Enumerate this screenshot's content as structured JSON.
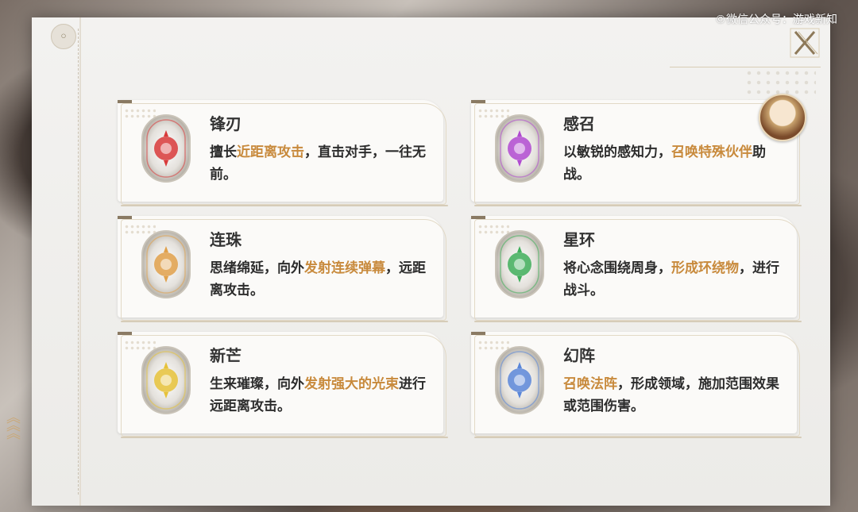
{
  "watermark": "©微信公众号：游戏新知",
  "colors": {
    "highlight": "#c88a3c",
    "panel": "#f3f2f0",
    "gold": "#c9a877"
  },
  "icons": {
    "close": "close-x-icon",
    "back": "back-circle-icon"
  },
  "cards": [
    {
      "title": "锋刃",
      "desc_parts": [
        "擅长",
        "近距离攻击",
        "，直击对手，一往无前。"
      ],
      "emblem_color": "#d83a3a",
      "emblem": "blade-emblem-icon"
    },
    {
      "title": "感召",
      "desc_parts": [
        "以敏锐的感知力，",
        "召唤特殊伙伴",
        "助战。"
      ],
      "emblem_color": "#b04ad0",
      "emblem": "summon-emblem-icon"
    },
    {
      "title": "连珠",
      "desc_parts": [
        "思绪绵延，向外",
        "发射连续弹幕",
        "，远距离攻击。"
      ],
      "emblem_color": "#e0a04a",
      "emblem": "barrage-emblem-icon"
    },
    {
      "title": "星环",
      "desc_parts": [
        "将心念围绕周身，",
        "形成环绕物",
        "，进行战斗。"
      ],
      "emblem_color": "#3fae5a",
      "emblem": "ring-emblem-icon"
    },
    {
      "title": "新芒",
      "desc_parts": [
        "生来璀璨，向外",
        "发射强大的光束",
        "进行远距离攻击。"
      ],
      "emblem_color": "#e6c23a",
      "emblem": "beam-emblem-icon"
    },
    {
      "title": "幻阵",
      "desc_parts": [
        "",
        "召唤法阵",
        "，形成领域，施加范围效果或范围伤害。"
      ],
      "emblem_color": "#5a86d8",
      "emblem": "array-emblem-icon"
    }
  ]
}
